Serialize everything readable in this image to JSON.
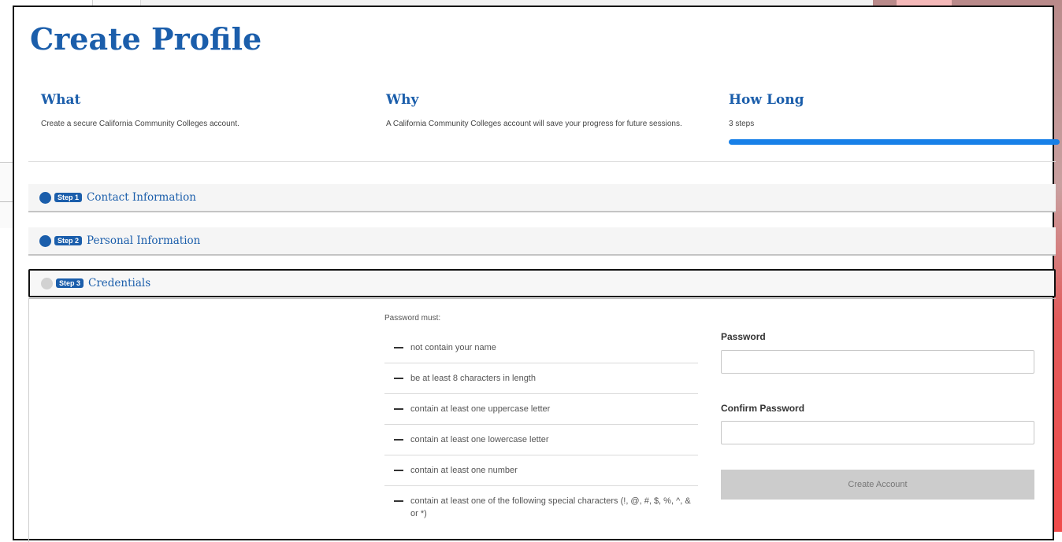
{
  "page": {
    "title": "Create Profile"
  },
  "info": {
    "what": {
      "heading": "What",
      "text": "Create a secure California Community Colleges account."
    },
    "why": {
      "heading": "Why",
      "text": "A California Community Colleges account will save your progress for future sessions."
    },
    "how_long": {
      "heading": "How Long",
      "text": "3 steps",
      "progress_fraction": 1.0
    }
  },
  "steps": [
    {
      "badge": "Step 1",
      "title": "Contact Information",
      "state": "complete"
    },
    {
      "badge": "Step 2",
      "title": "Personal Information",
      "state": "complete"
    },
    {
      "badge": "Step 3",
      "title": "Credentials",
      "state": "active"
    }
  ],
  "credentials": {
    "rules_heading": "Password must:",
    "rules": [
      "not contain your name",
      "be at least 8 characters in length",
      "contain at least one uppercase letter",
      "contain at least one lowercase letter",
      "contain at least one number",
      "contain at least one of the following special characters (!, @, #, $, %, ^, & or *)"
    ],
    "password_label": "Password",
    "password_value": "",
    "confirm_label": "Confirm Password",
    "confirm_value": "",
    "submit_label": "Create Account"
  },
  "colors": {
    "brand": "#1b5eab",
    "progress": "#1780e8",
    "disabled_button": "#cccccc"
  }
}
